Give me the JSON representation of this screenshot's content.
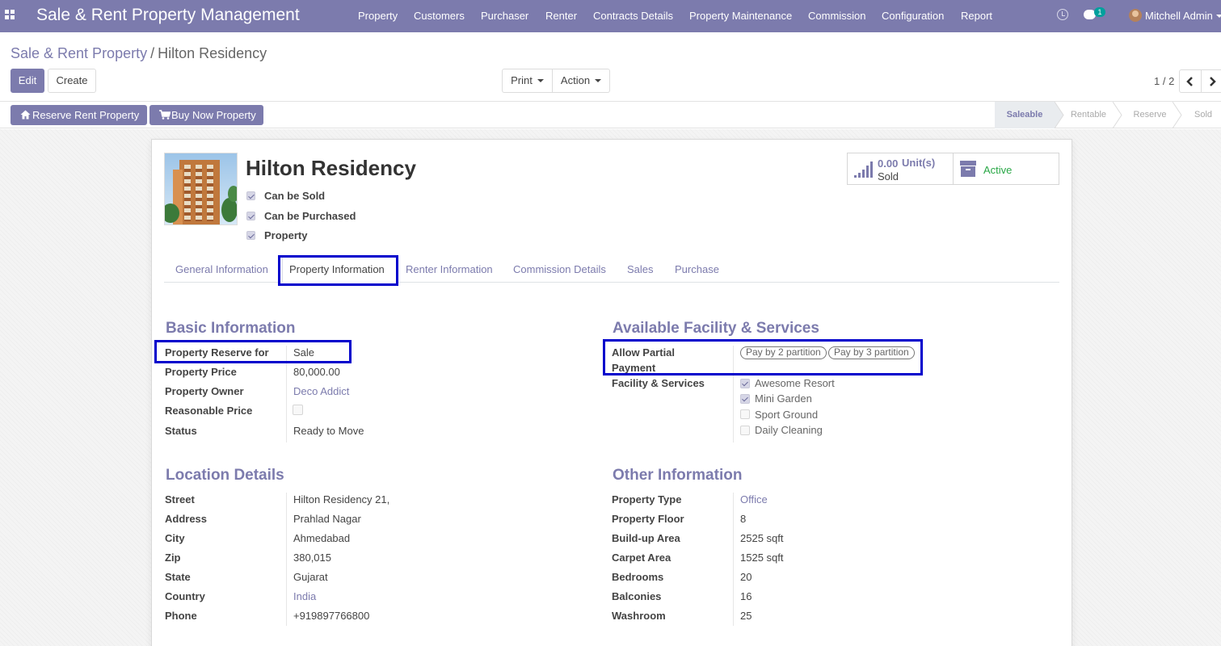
{
  "navbar": {
    "app_title": "Sale & Rent Property Management",
    "menu": [
      "Property",
      "Customers",
      "Purchaser",
      "Renter",
      "Contracts Details",
      "Property Maintenance",
      "Commission",
      "Configuration",
      "Report"
    ],
    "chat_count": "1",
    "user_name": "Mitchell Admin"
  },
  "breadcrumb": {
    "parent": "Sale & Rent Property",
    "separator": "/",
    "current": "Hilton Residency"
  },
  "toolbar": {
    "edit": "Edit",
    "create": "Create",
    "print": "Print",
    "action": "Action"
  },
  "pager": {
    "value": "1 / 2"
  },
  "statusbar": {
    "buttons": [
      "Reserve Rent Property",
      "Buy Now Property"
    ],
    "stages": [
      "Saleable",
      "Rentable",
      "Reserve",
      "Sold"
    ],
    "current_stage": "Saleable"
  },
  "record": {
    "name": "Hilton Residency",
    "flags": [
      {
        "label": "Can be Sold",
        "checked": true
      },
      {
        "label": "Can be Purchased",
        "checked": true
      },
      {
        "label": "Property",
        "checked": true
      }
    ],
    "sold_value": "0.00",
    "sold_unit": "Unit(s)",
    "sold_label": "Sold",
    "active_label": "Active"
  },
  "tabs": [
    "General Information",
    "Property Information",
    "Renter Information",
    "Commission Details",
    "Sales",
    "Purchase"
  ],
  "active_tab": "Property Information",
  "basic_info": {
    "title": "Basic Information",
    "fields": [
      {
        "label": "Property Reserve for",
        "value": "Sale"
      },
      {
        "label": "Property Price",
        "value": "80,000.00"
      },
      {
        "label": "Property Owner",
        "value": "Deco Addict"
      },
      {
        "label": "Reasonable Price",
        "value": ""
      },
      {
        "label": "Status",
        "value": "Ready to Move"
      }
    ]
  },
  "facility": {
    "title": "Available Facility & Services",
    "partial_payment_label": "Allow Partial Payment",
    "partial_payment_label_line1": "Allow Partial",
    "partial_payment_label_line2": "Payment",
    "partial_payment_tags": [
      "Pay by 2 partition",
      "Pay by 3 partition"
    ],
    "services_label": "Facility & Services",
    "services": [
      {
        "label": "Awesome Resort",
        "checked": true
      },
      {
        "label": "Mini Garden",
        "checked": true
      },
      {
        "label": "Sport Ground",
        "checked": false
      },
      {
        "label": "Daily Cleaning",
        "checked": false
      }
    ]
  },
  "location": {
    "title": "Location Details",
    "fields": [
      {
        "label": "Street",
        "value": "Hilton Residency 21,"
      },
      {
        "label": "Address",
        "value": "Prahlad Nagar"
      },
      {
        "label": "City",
        "value": "Ahmedabad"
      },
      {
        "label": "Zip",
        "value": "380,015"
      },
      {
        "label": "State",
        "value": "Gujarat"
      },
      {
        "label": "Country",
        "value": "India"
      },
      {
        "label": "Phone",
        "value": "+919897766800"
      }
    ]
  },
  "other_info": {
    "title": "Other Information",
    "fields": [
      {
        "label": "Property Type",
        "value": "Office"
      },
      {
        "label": "Property Floor",
        "value": "8"
      },
      {
        "label": "Build-up Area",
        "value": "2525 sqft"
      },
      {
        "label": "Carpet Area",
        "value": "1525 sqft"
      },
      {
        "label": "Bedrooms",
        "value": "20"
      },
      {
        "label": "Balconies",
        "value": "16"
      },
      {
        "label": "Washroom",
        "value": "25"
      }
    ]
  },
  "colors": {
    "brand": "#7c7bad",
    "highlight": "#0000cc",
    "active": "#28a745"
  },
  "icons": [
    "apps-icon",
    "clock-icon",
    "chat-icon",
    "home-icon",
    "cart-icon",
    "chevron-left-icon",
    "chevron-right-icon",
    "signal-bars-icon",
    "archive-icon"
  ]
}
